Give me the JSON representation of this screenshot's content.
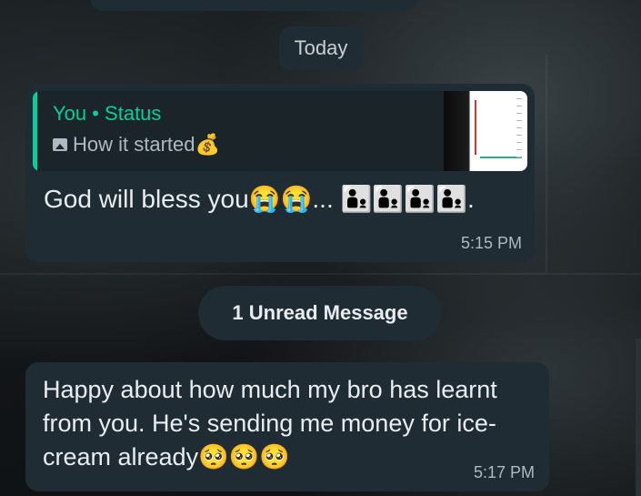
{
  "chat": {
    "date_separator": "Today",
    "unread_separator": "1 Unread Message"
  },
  "messages": [
    {
      "quote": {
        "author": "You • Status",
        "text": "How it started💰",
        "media_icon": "image-icon"
      },
      "text": "God will bless you😭😭... 👨‍👦👨‍👦👨‍👦👨‍👦.",
      "time": "5:15 PM"
    },
    {
      "text": "Happy about how much my bro has learnt from you.  He's sending me money for ice-cream already🥺🥺🥺",
      "time": "5:17 PM"
    }
  ],
  "colors": {
    "bubble": "#1f2c33",
    "quote_accent": "#06cf9c",
    "text": "#e9edef",
    "meta": "#aebac1"
  }
}
